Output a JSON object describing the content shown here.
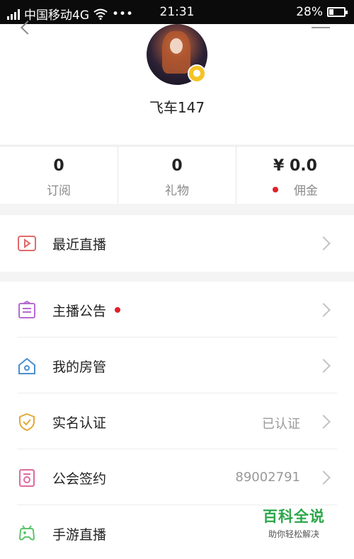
{
  "status_bar": {
    "carrier": "中国移动4G",
    "more": "•••",
    "time": "21:31",
    "battery_percent": "28%",
    "battery_level": 0.28
  },
  "profile": {
    "username": "飞车147",
    "badge_color": "#f5c424"
  },
  "stats": [
    {
      "value": "0",
      "label": "订阅"
    },
    {
      "value": "0",
      "label": "礼物"
    },
    {
      "value": "¥ 0.0",
      "label": "佣金",
      "dot": true
    }
  ],
  "menu_primary": [
    {
      "label": "最近直播",
      "icon": "play-icon",
      "color": "#e06a6a"
    }
  ],
  "menu_secondary": [
    {
      "label": "主播公告",
      "icon": "announcement-icon",
      "color": "#b66ad0",
      "dot": true
    },
    {
      "label": "我的房管",
      "icon": "home-manager-icon",
      "color": "#4a8fd0"
    },
    {
      "label": "实名认证",
      "icon": "shield-check-icon",
      "color": "#e3a935",
      "value": "已认证"
    },
    {
      "label": "公会签约",
      "icon": "contract-icon",
      "color": "#e06aa0",
      "value": "89002791"
    },
    {
      "label": "手游直播",
      "icon": "gamepad-icon",
      "color": "#5cc46a"
    }
  ],
  "watermark": {
    "title": "百科全说",
    "subtitle": "助你轻松解决"
  }
}
